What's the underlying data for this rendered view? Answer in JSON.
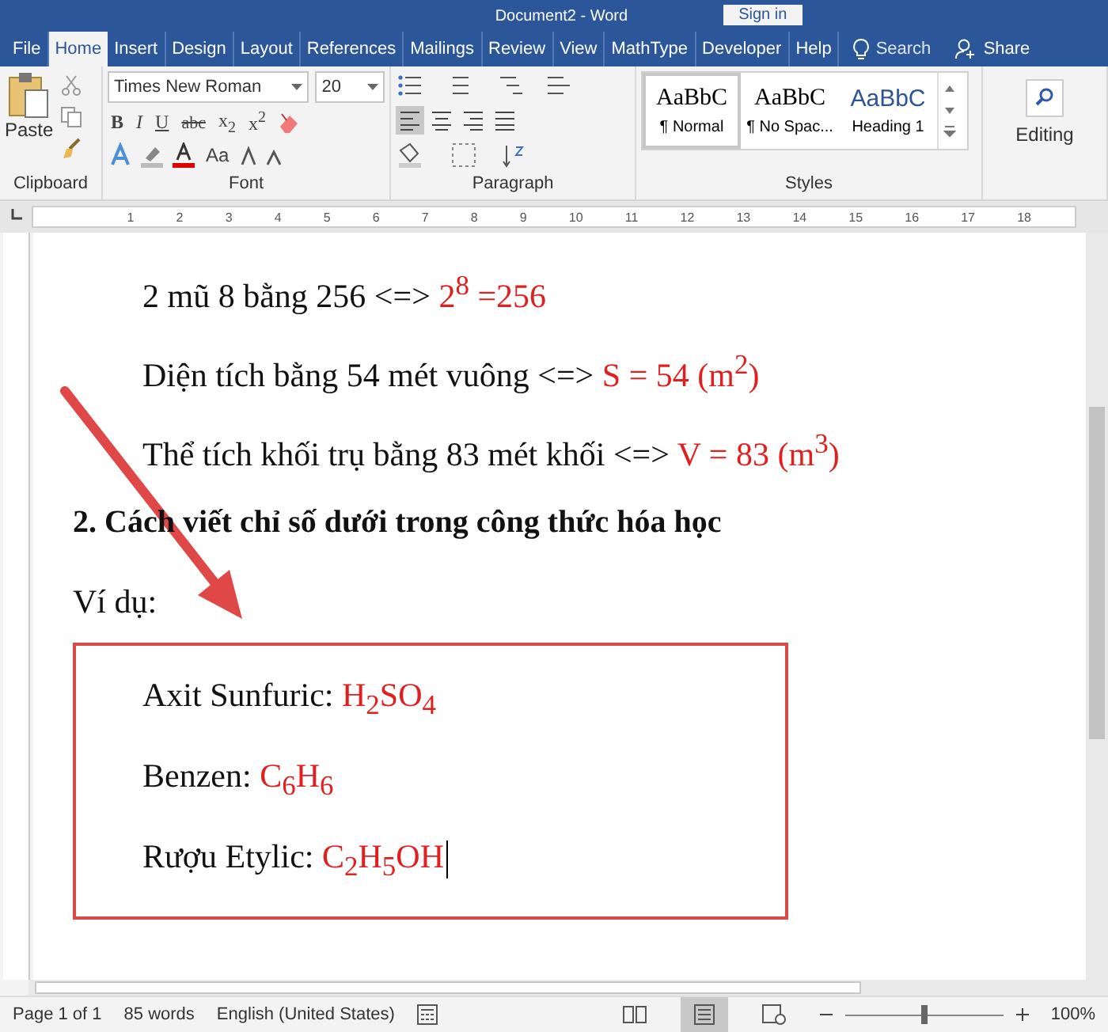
{
  "window": {
    "title": "Document2 - Word",
    "sign_in": "Sign in"
  },
  "tabs": [
    {
      "label": "File",
      "selected": false
    },
    {
      "label": "Home",
      "selected": true
    },
    {
      "label": "Insert",
      "selected": false
    },
    {
      "label": "Design",
      "selected": false
    },
    {
      "label": "Layout",
      "selected": false
    },
    {
      "label": "References",
      "selected": false
    },
    {
      "label": "Mailings",
      "selected": false
    },
    {
      "label": "Review",
      "selected": false
    },
    {
      "label": "View",
      "selected": false
    },
    {
      "label": "MathType",
      "selected": false
    },
    {
      "label": "Developer",
      "selected": false
    },
    {
      "label": "Help",
      "selected": false
    }
  ],
  "search": {
    "placeholder": "Search"
  },
  "share": "Share",
  "ribbon": {
    "clipboard": {
      "paste": "Paste",
      "label": "Clipboard"
    },
    "font": {
      "name": "Times New Roman",
      "size": "20",
      "buttons": [
        "B",
        "I",
        "U",
        "abc",
        "x$_{2}$",
        "x$^{2}$"
      ],
      "case_button": "Aa",
      "label": "Font"
    },
    "paragraph": {
      "label": "Paragraph"
    },
    "styles": {
      "items": [
        {
          "preview": "AaBbC",
          "name": "¶ Normal",
          "selected": true,
          "kind": "normal"
        },
        {
          "preview": "AaBbC",
          "name": "¶ No Spac...",
          "selected": false,
          "kind": "normal"
        },
        {
          "preview": "AaBbC",
          "name": "Heading 1",
          "selected": false,
          "kind": "heading"
        }
      ],
      "label": "Styles"
    },
    "editing": {
      "label": "Editing"
    }
  },
  "ruler": [
    "1",
    "2",
    "3",
    "4",
    "5",
    "6",
    "7",
    "8",
    "9",
    "10",
    "11",
    "12",
    "13",
    "14",
    "15",
    "16",
    "17",
    "18"
  ],
  "document": {
    "lines": [
      {
        "text": "2 mũ 8 bằng 256 <=> ",
        "formula": "2$^{8}$ =256"
      },
      {
        "text": "Diện tích bằng 54 mét vuông <=> ",
        "formula": "S = 54 (m$^{2}$)"
      },
      {
        "text": "Thể tích khối trụ bằng 83 mét khối <=> ",
        "formula": "V = 83 (m$^{3}$)"
      }
    ],
    "heading": "2. Cách viết chỉ số dưới trong công thức hóa học",
    "example_label": "Ví dụ:",
    "examples": [
      {
        "text": "Axit Sunfuric: ",
        "formula": "H$_{2}$SO$_{4}$",
        "caret": false
      },
      {
        "text": "Benzen: ",
        "formula": "C$_{6}$H$_{6}$",
        "caret": false
      },
      {
        "text": "Rượu Etylic: ",
        "formula": "C$_{2}$H$_{5}$OH",
        "caret": true
      }
    ]
  },
  "status_bar": {
    "page": "Page 1 of 1",
    "words": "85 words",
    "language": "English (United States)",
    "views": [
      {
        "kind": "read",
        "selected": false
      },
      {
        "kind": "print",
        "selected": true
      },
      {
        "kind": "web",
        "selected": false
      }
    ],
    "zoom_slider": {
      "level": 0.5
    },
    "zoom": "100%"
  }
}
